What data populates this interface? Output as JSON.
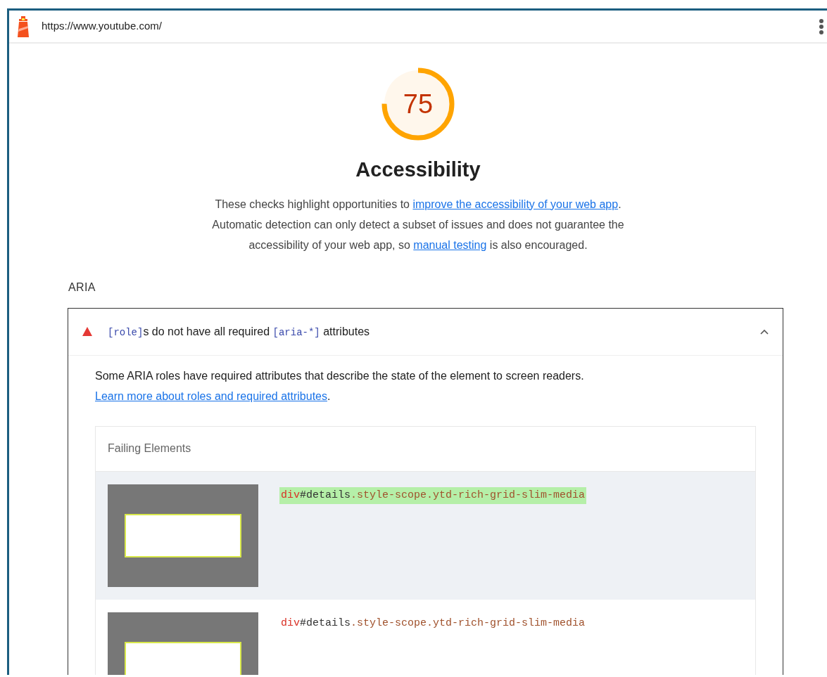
{
  "url_bar": {
    "url": "https://www.youtube.com/"
  },
  "score": {
    "value": "75",
    "level": 0.75,
    "title": "Accessibility"
  },
  "description": [
    {
      "kind": "text",
      "text": "These checks highlight opportunities to "
    },
    {
      "kind": "link",
      "text": "improve the accessibility of your web app"
    },
    {
      "kind": "text",
      "text": ". Automatic detection can only detect a subset of issues and does not guarantee the accessibility of your web app, so "
    },
    {
      "kind": "link",
      "text": "manual testing"
    },
    {
      "kind": "text",
      "text": " is also encouraged."
    }
  ],
  "group": {
    "title": "ARIA"
  },
  "audit": {
    "expanded": true,
    "title": [
      {
        "kind": "code",
        "text": "[role]"
      },
      {
        "kind": "text",
        "text": "s do not have all required "
      },
      {
        "kind": "code",
        "text": "[aria-*]"
      },
      {
        "kind": "text",
        "text": " attributes"
      }
    ],
    "description": [
      {
        "kind": "text",
        "text": "Some ARIA roles have required attributes that describe the state of the element to screen readers. "
      },
      {
        "kind": "link",
        "text": "Learn more about roles and required attributes"
      },
      {
        "kind": "text",
        "text": "."
      }
    ],
    "table": {
      "header": "Failing Elements",
      "rows": [
        {
          "selected": true,
          "tag": "div",
          "id": "#details",
          "classes": ".style-scope.ytd-rich-grid-slim-media"
        },
        {
          "selected": false,
          "tag": "div",
          "id": "#details",
          "classes": ".style-scope.ytd-rich-grid-slim-media"
        }
      ]
    }
  }
}
